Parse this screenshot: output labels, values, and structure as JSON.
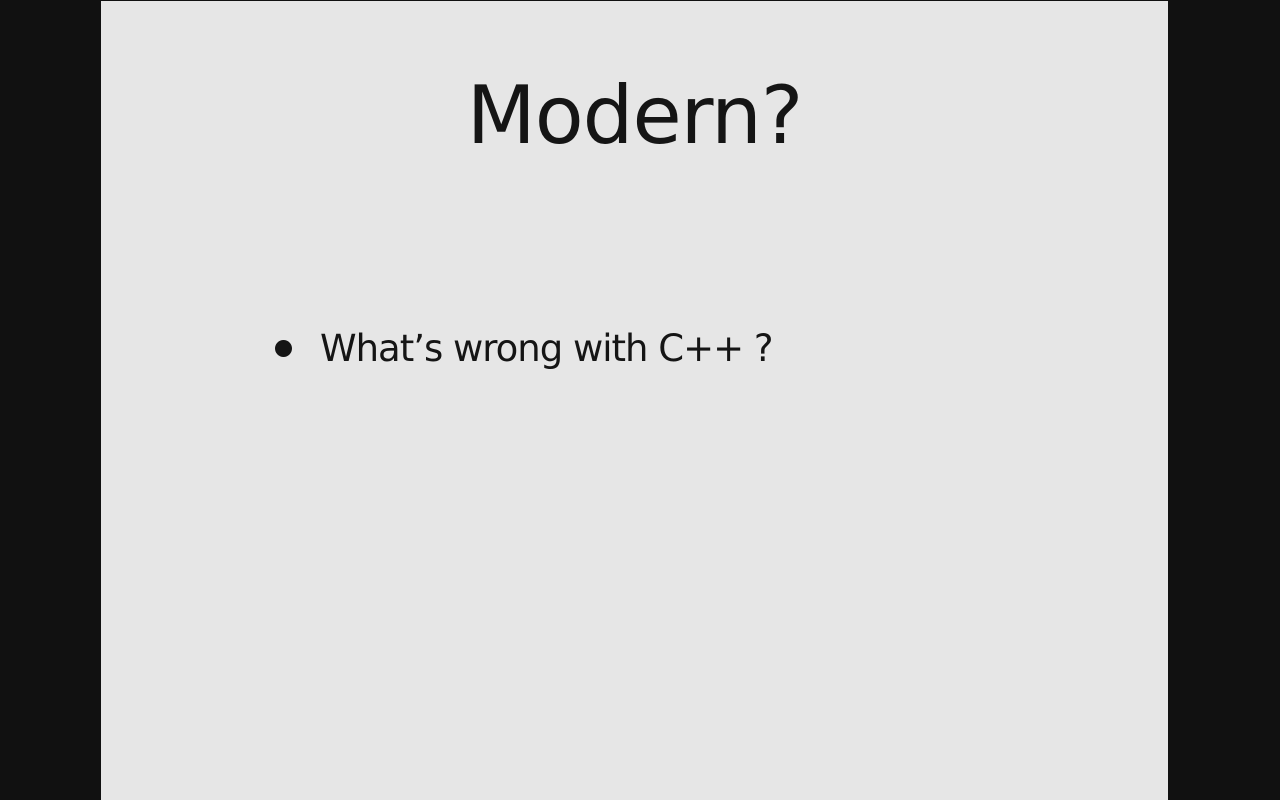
{
  "slide": {
    "title": "Modern?",
    "bullets": [
      "What’s wrong with C++ ?"
    ]
  },
  "colors": {
    "background": "#e6e6e6",
    "frame": "#111111",
    "text": "#151515"
  }
}
